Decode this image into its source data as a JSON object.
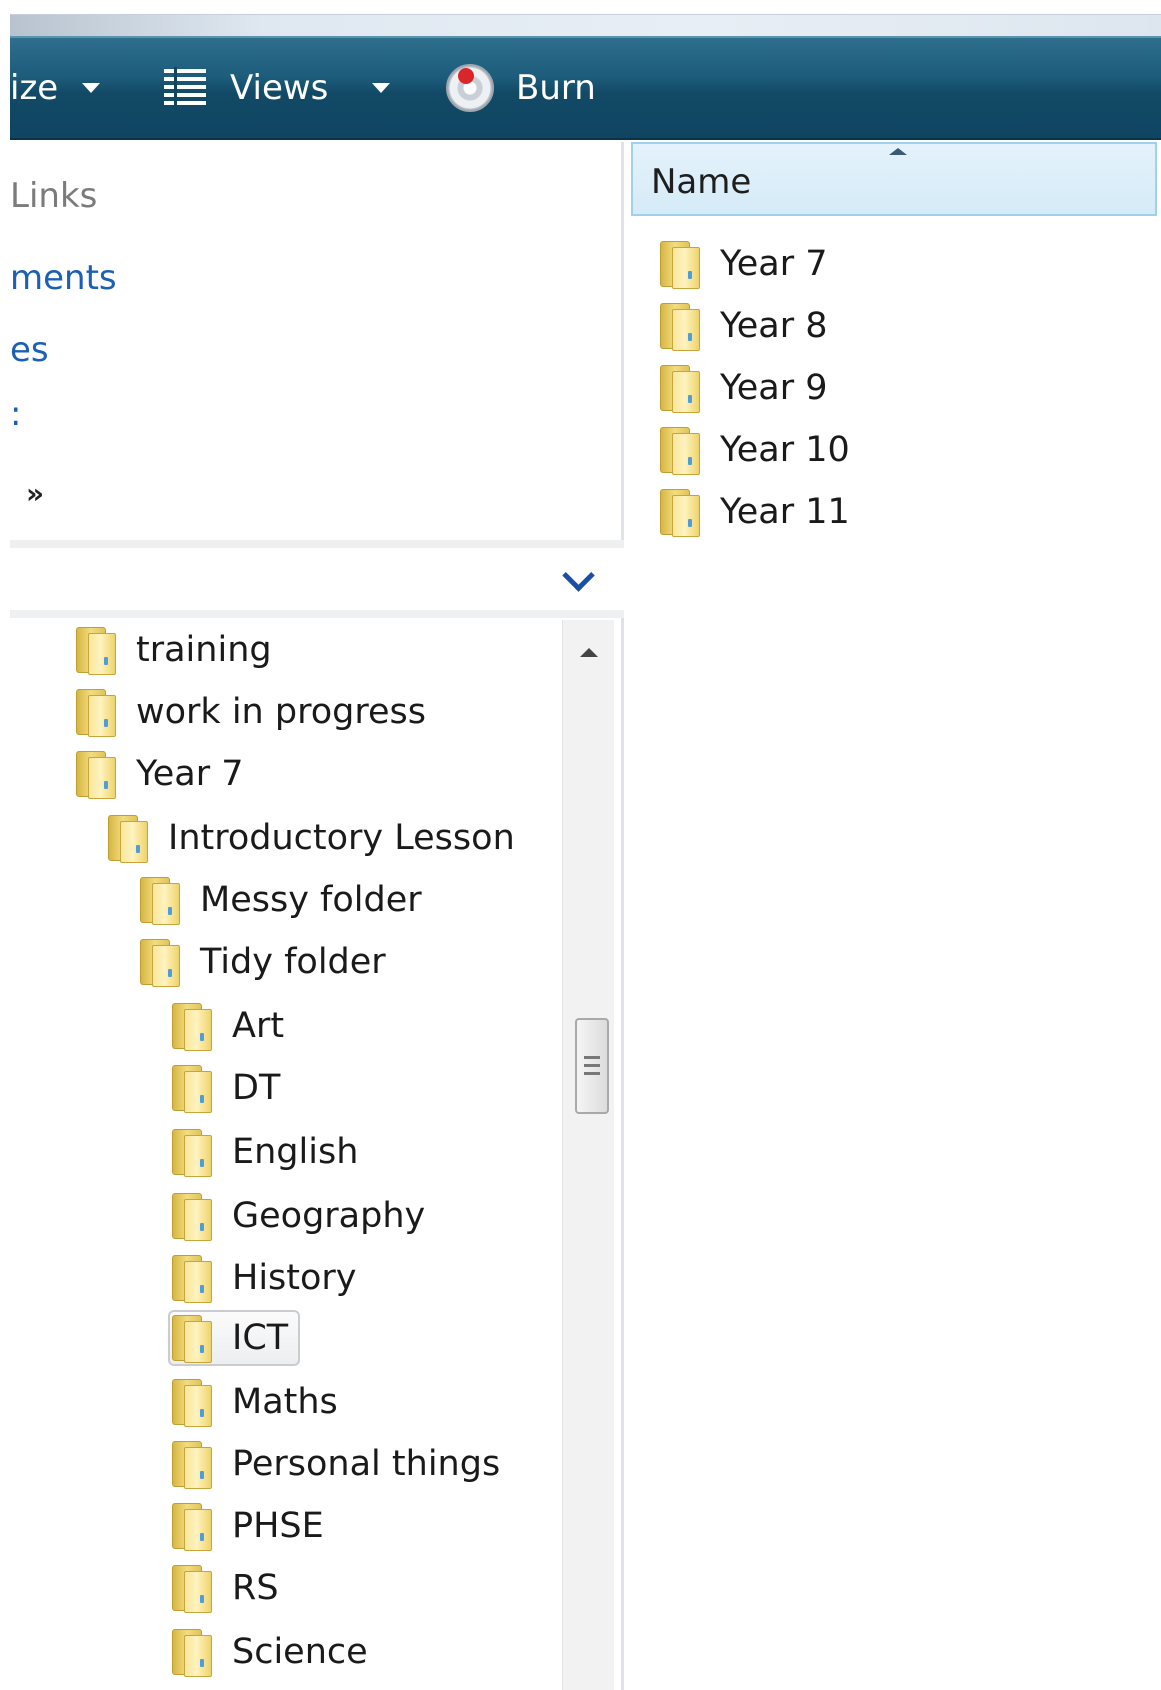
{
  "toolbar": {
    "organize_label": "ize",
    "views_label": "Views",
    "burn_label": "Burn",
    "icons": [
      "dropdown-arrow-icon",
      "views-icon",
      "burn-disc-icon"
    ]
  },
  "favorites": {
    "links_label": "Links",
    "items": [
      "ments",
      "es",
      ":"
    ],
    "more_label": "»"
  },
  "tree": {
    "items": [
      {
        "label": "training"
      },
      {
        "label": "work in progress"
      },
      {
        "label": "Year 7"
      },
      {
        "label": "Introductory Lesson"
      },
      {
        "label": "Messy folder"
      },
      {
        "label": "Tidy folder"
      },
      {
        "label": "Art"
      },
      {
        "label": "DT"
      },
      {
        "label": "English"
      },
      {
        "label": "Geography"
      },
      {
        "label": "History"
      },
      {
        "label": "ICT",
        "selected": true
      },
      {
        "label": "Maths"
      },
      {
        "label": "Personal things"
      },
      {
        "label": "PHSE"
      },
      {
        "label": "RS"
      },
      {
        "label": "Science"
      }
    ]
  },
  "list": {
    "column_name": "Name",
    "items": [
      "Year 7",
      "Year 8",
      "Year 9",
      "Year 10",
      "Year 11"
    ]
  },
  "colors": {
    "toolbar": "#1c5b7a",
    "link": "#1b60b5",
    "header": "#d5ebf8",
    "folder": "#f3dc7e"
  }
}
